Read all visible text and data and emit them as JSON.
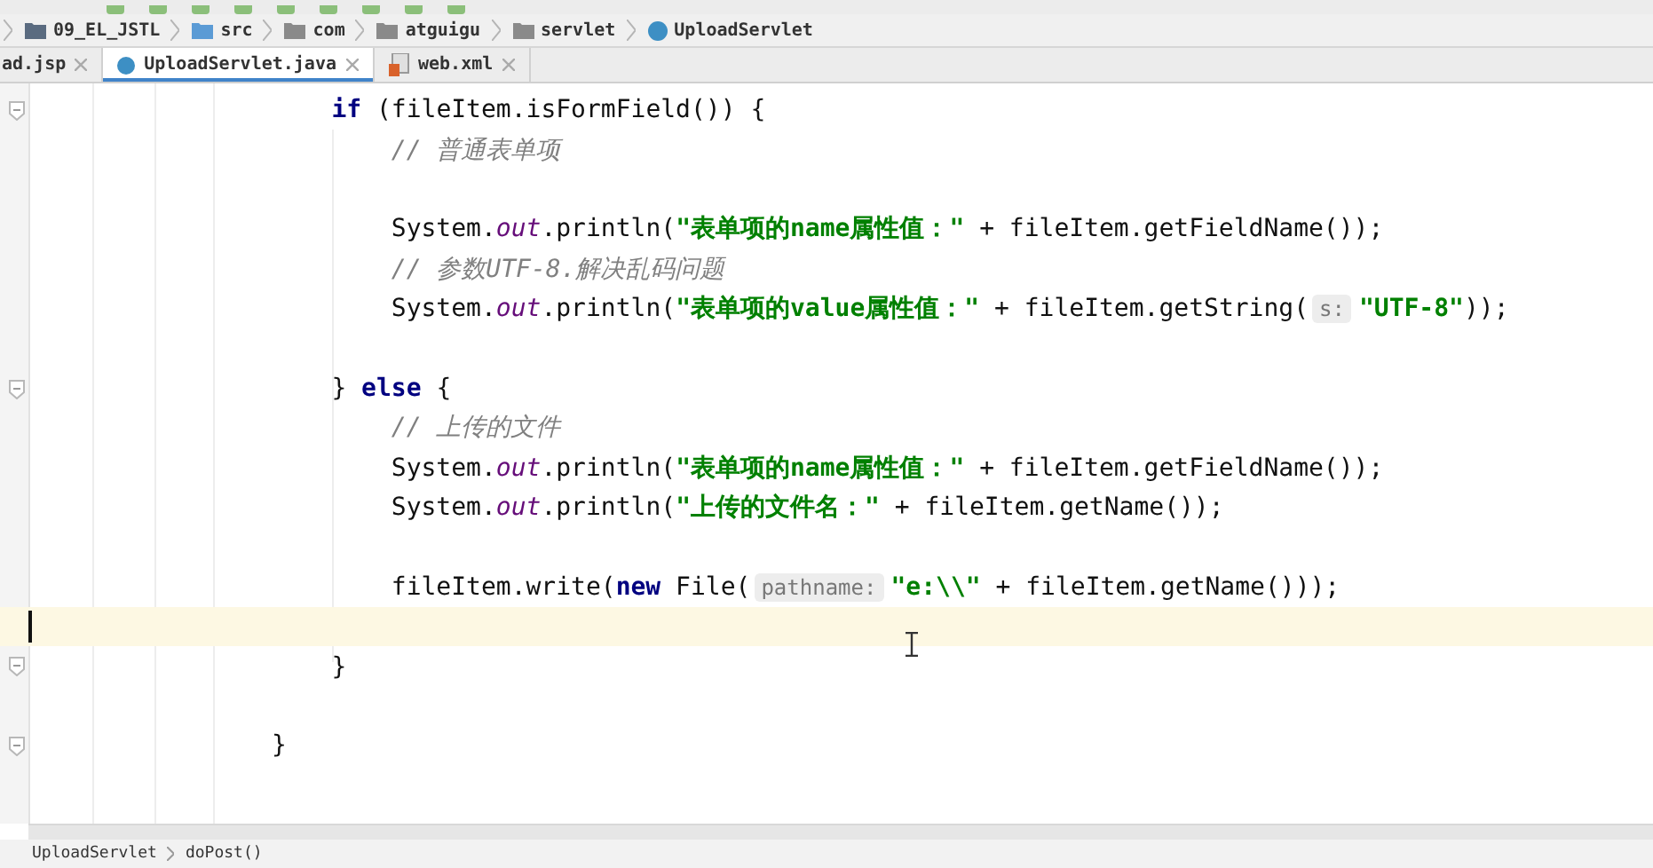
{
  "breadcrumb": [
    {
      "label": "09_EL_JSTL",
      "kind": "module"
    },
    {
      "label": "src",
      "kind": "source"
    },
    {
      "label": "com",
      "kind": "package"
    },
    {
      "label": "atguigu",
      "kind": "package"
    },
    {
      "label": "servlet",
      "kind": "package"
    },
    {
      "label": "UploadServlet",
      "kind": "class"
    }
  ],
  "tabs": [
    {
      "label": "ad.jsp",
      "selected": false,
      "kind": "jsp"
    },
    {
      "label": "UploadServlet.java",
      "selected": true,
      "kind": "class"
    },
    {
      "label": "web.xml",
      "selected": false,
      "kind": "xml"
    }
  ],
  "code": [
    {
      "children": [
        {
          "fold": true,
          "current": false,
          "tokens": [
            {
              "kind": "keyword",
              "s": "if"
            },
            {
              "kind": "plain",
              "s": " (fileItem.isFormField()) {"
            }
          ],
          "children": [
            {
              "fold": false,
              "current": false,
              "tokens": [
                {
                  "kind": "comment",
                  "s": "// 普通表单项"
                }
              ]
            },
            {
              "fold": false,
              "current": false
            },
            {
              "fold": false,
              "current": false,
              "tokens": [
                {
                  "kind": "plain",
                  "s": "System."
                },
                {
                  "kind": "field",
                  "s": "out"
                },
                {
                  "kind": "plain",
                  "s": ".println("
                },
                {
                  "kind": "string",
                  "s": "\"表单项的name属性值：\""
                },
                {
                  "kind": "plain",
                  "s": " + fileItem.getFieldName());"
                }
              ]
            },
            {
              "fold": false,
              "current": false,
              "tokens": [
                {
                  "kind": "comment",
                  "s": "// 参数UTF-8.解决乱码问题"
                }
              ]
            },
            {
              "fold": false,
              "current": false,
              "tokens": [
                {
                  "kind": "plain",
                  "s": "System."
                },
                {
                  "kind": "field",
                  "s": "out"
                },
                {
                  "kind": "plain",
                  "s": ".println("
                },
                {
                  "kind": "string",
                  "s": "\"表单项的value属性值：\""
                },
                {
                  "kind": "plain",
                  "s": " + fileItem.getString("
                },
                {
                  "kind": "hint",
                  "s": "s:"
                },
                {
                  "kind": "string",
                  "s": "\"UTF-8\""
                },
                {
                  "kind": "plain",
                  "s": "));"
                }
              ]
            },
            {
              "fold": false,
              "current": false
            }
          ]
        },
        {
          "fold": true,
          "current": false,
          "tokens": [
            {
              "kind": "plain",
              "s": "} "
            },
            {
              "kind": "keyword",
              "s": "else"
            },
            {
              "kind": "plain",
              "s": " {"
            }
          ],
          "children": [
            {
              "fold": false,
              "current": false,
              "tokens": [
                {
                  "kind": "comment",
                  "s": "// 上传的文件"
                }
              ]
            },
            {
              "fold": false,
              "current": false,
              "tokens": [
                {
                  "kind": "plain",
                  "s": "System."
                },
                {
                  "kind": "field",
                  "s": "out"
                },
                {
                  "kind": "plain",
                  "s": ".println("
                },
                {
                  "kind": "string",
                  "s": "\"表单项的name属性值：\""
                },
                {
                  "kind": "plain",
                  "s": " + fileItem.getFieldName());"
                }
              ]
            },
            {
              "fold": false,
              "current": false,
              "tokens": [
                {
                  "kind": "plain",
                  "s": "System."
                },
                {
                  "kind": "field",
                  "s": "out"
                },
                {
                  "kind": "plain",
                  "s": ".println("
                },
                {
                  "kind": "string",
                  "s": "\"上传的文件名：\""
                },
                {
                  "kind": "plain",
                  "s": " + fileItem.getName());"
                }
              ]
            },
            {
              "fold": false,
              "current": false
            },
            {
              "fold": false,
              "current": false,
              "tokens": [
                {
                  "kind": "plain",
                  "s": "fileItem.write("
                },
                {
                  "kind": "keyword",
                  "s": "new"
                },
                {
                  "kind": "plain",
                  "s": " File("
                },
                {
                  "kind": "hint",
                  "s": "pathname:"
                },
                {
                  "kind": "string",
                  "s": "\"e:\\\\\""
                },
                {
                  "kind": "plain",
                  "s": " + fileItem.getName()));"
                }
              ]
            },
            {
              "fold": false,
              "current": true
            }
          ]
        },
        {
          "fold": true,
          "current": false,
          "tokens": [
            {
              "kind": "plain",
              "s": "}"
            }
          ]
        },
        {
          "fold": false,
          "current": false
        }
      ]
    },
    {
      "fold": true,
      "current": false,
      "tokens": [
        {
          "kind": "plain",
          "s": "}"
        }
      ]
    }
  ],
  "status_path": [
    "UploadServlet",
    "doPost()"
  ]
}
